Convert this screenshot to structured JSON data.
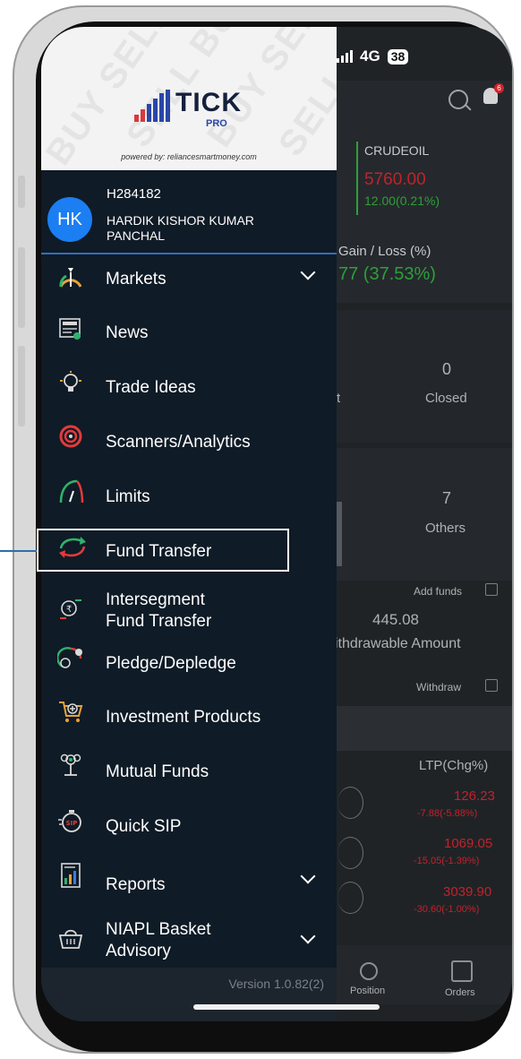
{
  "status_bar": {
    "network": "4G",
    "battery": "38"
  },
  "header": {
    "notification_count": "6"
  },
  "logo": {
    "brand": "TICK",
    "sub": "PRO",
    "powered_by": "powered by: reliancesmartmoney.com"
  },
  "user": {
    "initials": "HK",
    "id": "H284182",
    "name": "HARDIK KISHOR KUMAR PANCHAL"
  },
  "menu": {
    "markets": "Markets",
    "news": "News",
    "trade_ideas": "Trade Ideas",
    "scanners": "Scanners/Analytics",
    "limits": "Limits",
    "fund_transfer": "Fund Transfer",
    "intersegment_line1": "Intersegment",
    "intersegment_line2": "Fund Transfer",
    "pledge": "Pledge/Depledge",
    "investment_products": "Investment Products",
    "mutual_funds": "Mutual Funds",
    "quick_sip": "Quick SIP",
    "reports": "Reports",
    "niapl_line1": "NIAPL Basket",
    "niapl_line2": "Advisory"
  },
  "version": "Version 1.0.82(2)",
  "background": {
    "index_name": "CRUDEOIL",
    "index_value": "5760.00",
    "index_change": "12.00(0.21%)",
    "gain_loss_label": "Gain / Loss (%)",
    "gain_loss_value": "77 (37.53%)",
    "closed_count": "0",
    "closed_label": "Closed",
    "open_label_fragment": "t",
    "others_count": "7",
    "others_label": "Others",
    "add_funds": "Add funds",
    "withdrawable_value": "445.08",
    "withdrawable_label": "ithdrawable Amount",
    "withdraw": "Withdraw",
    "ltp_header": "LTP(Chg%)",
    "rows": [
      {
        "price": "126.23",
        "change": "-7.88(-5.88%)"
      },
      {
        "price": "1069.05",
        "change": "-15.05(-1.39%)"
      },
      {
        "price": "3039.90",
        "change": "-30.60(-1.00%)"
      }
    ],
    "nav_position": "Position",
    "nav_orders": "Orders"
  },
  "colors": {
    "drawer_bg": "#0f1b26",
    "accent_blue": "#1b7ef2",
    "loss_red": "#c0232b",
    "gain_green": "#2e9f3a"
  }
}
